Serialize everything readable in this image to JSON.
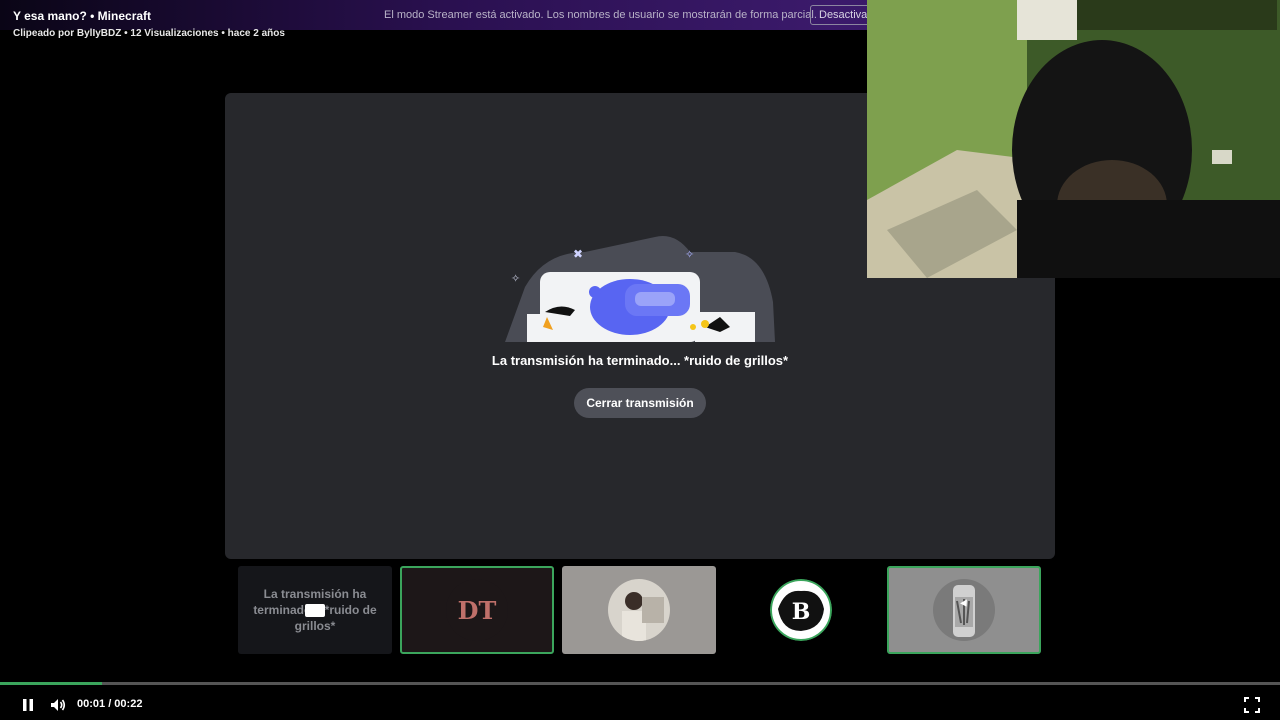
{
  "clip": {
    "title": "Y esa mano? • Minecraft",
    "meta": "Clipeado por BylIyBDZ • 12 Visualizaciones • hace 2 años"
  },
  "streamer_banner": {
    "message": "El modo Streamer está activado. Los nombres de usuario se mostrarán de forma parcial.",
    "deactivate_label": "Desactivar"
  },
  "stream": {
    "ended_message": "La transmisión ha terminado... *ruido de grillos*",
    "close_label": "Cerrar transmisión"
  },
  "thumbnails": [
    {
      "caption": "La transmisión ha terminado... *ruido de grillos*",
      "icon": "video-camera-icon",
      "active": false
    },
    {
      "avatar": "dt-logo",
      "active": true
    },
    {
      "avatar": "person-photo",
      "active": false
    },
    {
      "avatar": "b-logo",
      "active": false
    },
    {
      "avatar": "can-photo",
      "active": true
    }
  ],
  "player": {
    "time_display": "00:01 / 00:22",
    "progress": 0.08,
    "icons": [
      "pause-icon",
      "volume-icon",
      "fullscreen-icon"
    ]
  },
  "colors": {
    "accent_green": "#3ba55c",
    "panel_bg": "#27282c",
    "blurple": "#5865f2"
  }
}
